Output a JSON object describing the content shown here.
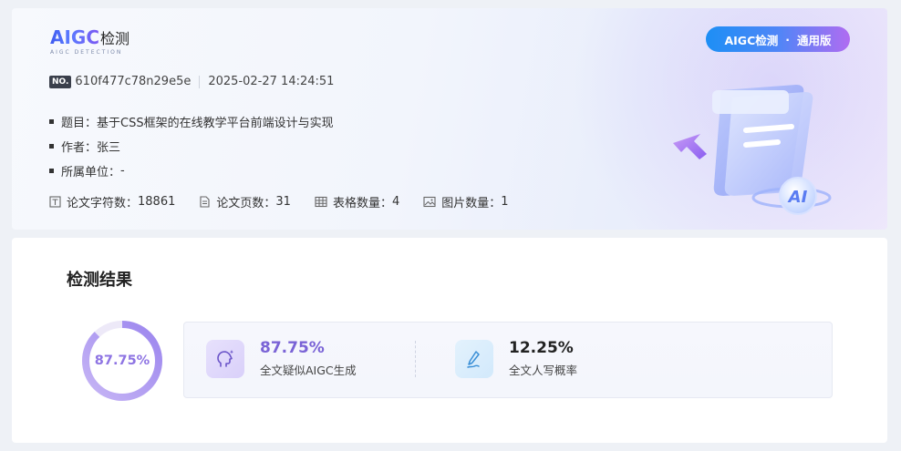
{
  "header": {
    "logo_text": "AIGC",
    "logo_cn": "检测",
    "logo_sub": "AIGC DETECTION",
    "badge_left": "AIGC检测",
    "badge_dot": "·",
    "badge_right": "通用版"
  },
  "report": {
    "no_tag": "NO.",
    "id": "610f477c78n29e5e",
    "datetime": "2025-02-27 14:24:51"
  },
  "info": [
    {
      "label": "题目：",
      "value": "基于CSS框架的在线教学平台前端设计与实现"
    },
    {
      "label": "作者：",
      "value": "张三"
    },
    {
      "label": "所属单位：",
      "value": "-"
    }
  ],
  "stats": [
    {
      "icon": "document-chars-icon",
      "label": "论文字符数：",
      "value": "18861"
    },
    {
      "icon": "page-count-icon",
      "label": "论文页数：",
      "value": "31"
    },
    {
      "icon": "table-icon",
      "label": "表格数量：",
      "value": "4"
    },
    {
      "icon": "image-icon",
      "label": "图片数量：",
      "value": "1"
    }
  ],
  "result": {
    "title": "检测结果",
    "ring_text": "87.75%",
    "ring_fraction": 0.8775,
    "ai": {
      "value": "87.75%",
      "label": "全文疑似AIGC生成",
      "icon": "ai-head-icon",
      "color": "#7a63d6"
    },
    "human": {
      "value": "12.25%",
      "label": "全文人写概率",
      "icon": "pen-write-icon",
      "color": "#222222"
    }
  },
  "illustration": {
    "badge_text": "AI"
  },
  "colors": {
    "accent_purple": "#8e74e3",
    "accent_blue": "#1d8ff5",
    "ring_track": "#ede9f8"
  }
}
